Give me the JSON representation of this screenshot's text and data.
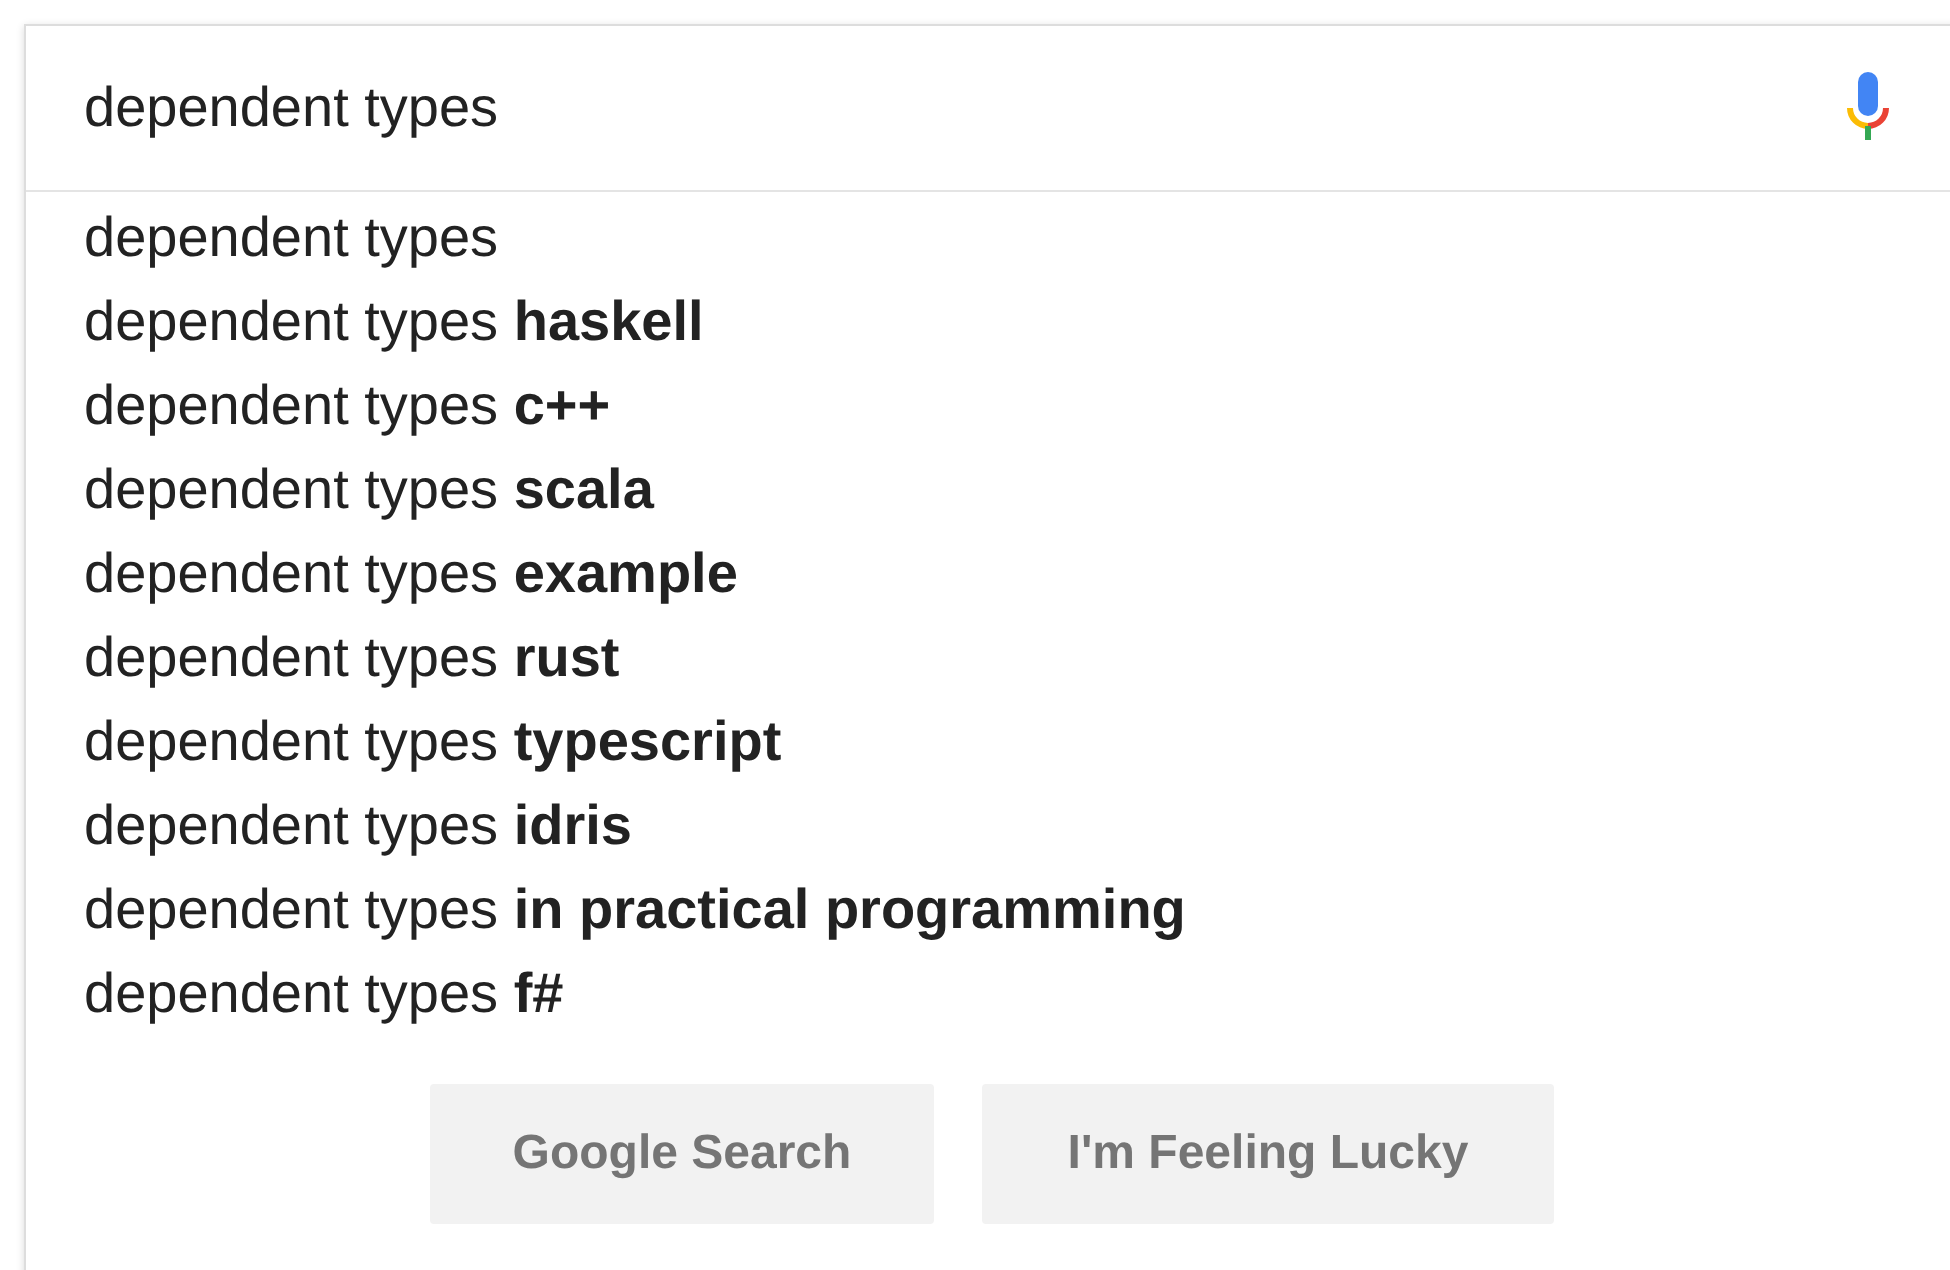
{
  "search": {
    "value": "dependent types"
  },
  "suggestions": [
    "dependent types",
    "dependent types **haskell**",
    "dependent types **c++**",
    "dependent types **scala**",
    "dependent types **example**",
    "dependent types **rust**",
    "dependent types **typescript**",
    "dependent types **idris**",
    "dependent types **in practical programming**",
    "dependent types **f#**"
  ],
  "buttons": [
    "Google Search",
    "I'm Feeling Lucky"
  ]
}
